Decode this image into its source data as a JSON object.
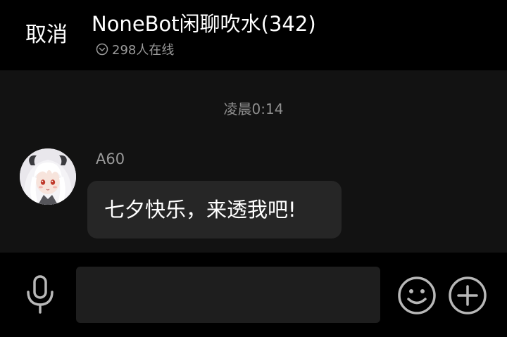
{
  "header": {
    "cancel_label": "取消",
    "title": "NoneBot闲聊吹水(342)",
    "online_text": "298人在线",
    "online_icon": "chevron-down-circle-icon"
  },
  "chat": {
    "timestamp": "凌晨0:14",
    "messages": [
      {
        "sender": "A60",
        "text": "七夕快乐，来透我吧!",
        "avatar": "anime-girl-avatar"
      }
    ]
  },
  "input_bar": {
    "mic_icon": "microphone-icon",
    "input_value": "",
    "emoji_icon": "smiley-icon",
    "plus_icon": "plus-circle-icon"
  },
  "colors": {
    "background": "#000000",
    "chat_background": "#121212",
    "bubble": "#262626",
    "input_field": "#1e1e1e",
    "text_primary": "#ffffff",
    "text_secondary": "#9b9b9b"
  }
}
